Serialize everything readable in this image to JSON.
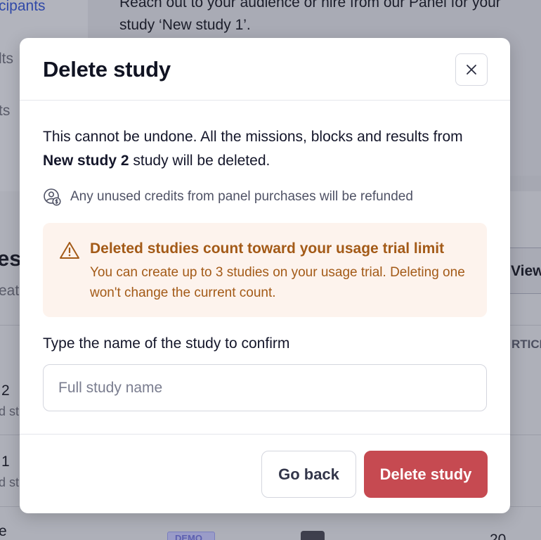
{
  "background": {
    "participants_link": "cipants",
    "results_partial": "lts",
    "settings_partial": "ts",
    "banner_line1": "Reach out to your audience or hire from our Panel for your",
    "banner_line2": "study ‘New study 1’.",
    "section_heading_partial": "es",
    "section_sub_partial": "eate",
    "view_button_partial": "View",
    "column_header_partial": "RTICI",
    "row1_title_partial": "2",
    "row1_sub_partial": "d st",
    "row2_title_partial": "1",
    "row2_sub_partial": "d st",
    "row3_title_partial": "e",
    "row3_badge": "DEMO",
    "row3_count": "20"
  },
  "modal": {
    "title": "Delete study",
    "description_prefix": "This cannot be undone. All the missions, blocks and results from ",
    "study_name": "New study 2",
    "description_suffix": " study will be deleted.",
    "refund_note": "Any unused credits from panel purchases will be refunded",
    "alert": {
      "title": "Deleted studies count toward your usage trial limit",
      "body": "You can create up to 3 studies on your usage trial. Deleting one won't change the current count."
    },
    "input_label": "Type the name of the study to confirm",
    "input_placeholder": "Full study name",
    "input_value": "",
    "back_button": "Go back",
    "delete_button": "Delete study"
  },
  "colors": {
    "overlay": "#a6a8b2",
    "warning_text": "#a35a17",
    "warning_bg": "#fdf3ed",
    "danger": "#c64a51"
  },
  "icons": [
    "close-icon",
    "coin-user-icon",
    "warning-triangle-icon"
  ]
}
